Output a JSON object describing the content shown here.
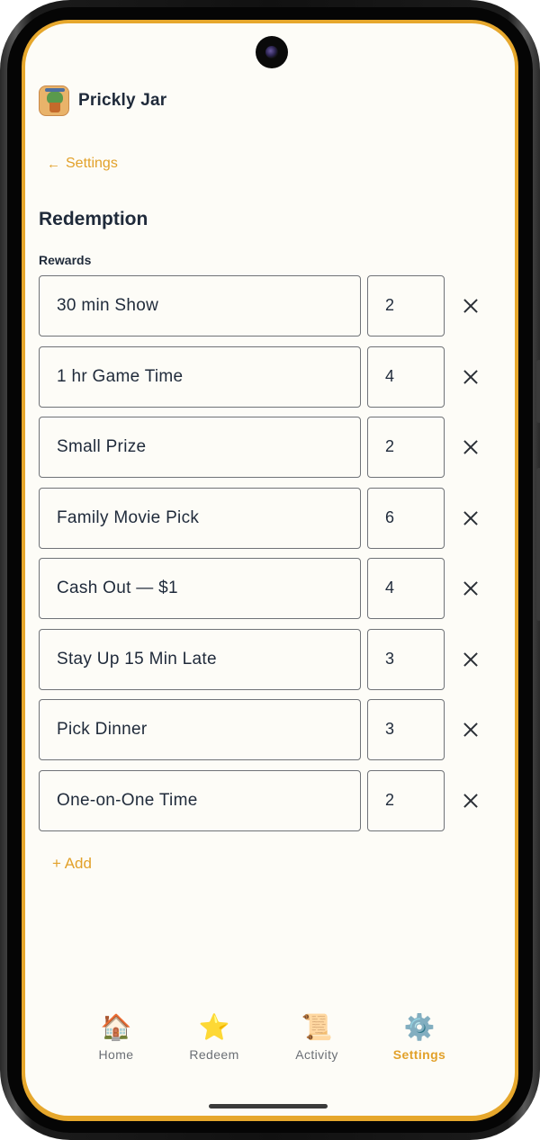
{
  "app": {
    "name": "Prickly Jar"
  },
  "back_link": {
    "arrow": "←",
    "label": "Settings"
  },
  "page": {
    "title": "Redemption",
    "rewards_label": "Rewards"
  },
  "rewards": [
    {
      "name": "30 min Show",
      "cost": "2"
    },
    {
      "name": "1 hr Game Time",
      "cost": "4"
    },
    {
      "name": "Small Prize",
      "cost": "2"
    },
    {
      "name": "Family Movie Pick",
      "cost": "6"
    },
    {
      "name": "Cash Out — $1",
      "cost": "4"
    },
    {
      "name": "Stay Up 15 Min Late",
      "cost": "3"
    },
    {
      "name": "Pick Dinner",
      "cost": "3"
    },
    {
      "name": "One-on-One Time",
      "cost": "2"
    }
  ],
  "add_label": "+ Add",
  "nav": [
    {
      "label": "Home",
      "icon": "🏠",
      "icon_name": "house-icon",
      "active": false
    },
    {
      "label": "Redeem",
      "icon": "⭐",
      "icon_name": "star-icon",
      "active": false
    },
    {
      "label": "Activity",
      "icon": "📜",
      "icon_name": "scroll-icon",
      "active": false
    },
    {
      "label": "Settings",
      "icon": "⚙️",
      "icon_name": "gear-icon",
      "active": true
    }
  ],
  "colors": {
    "accent": "#e2a12a",
    "frame": "#e6a72c",
    "background": "#fdfcf7",
    "text": "#1f2a3a"
  }
}
